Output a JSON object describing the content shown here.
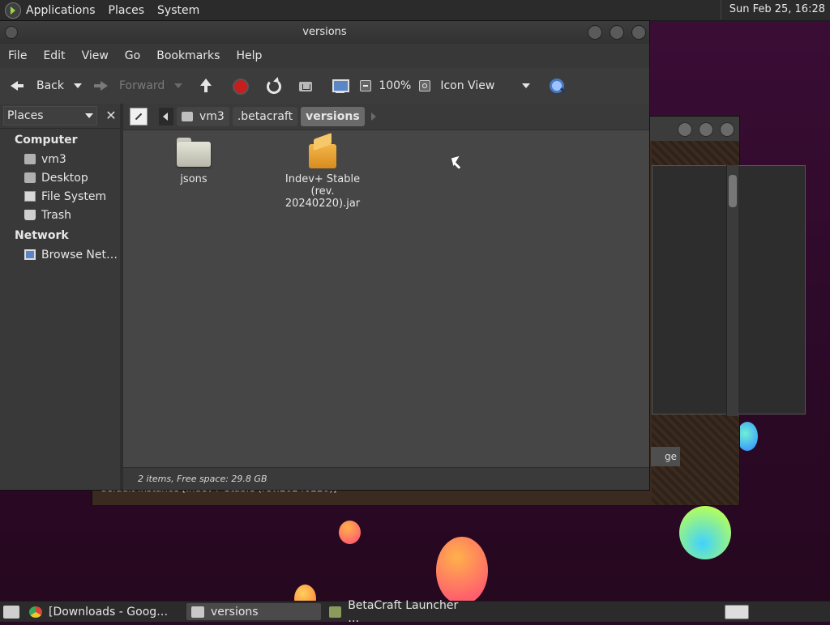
{
  "top_panel": {
    "menus": [
      "Applications",
      "Places",
      "System"
    ],
    "clock": "Sun Feb 25, 16:28"
  },
  "window": {
    "title": "versions",
    "menu": [
      "File",
      "Edit",
      "View",
      "Go",
      "Bookmarks",
      "Help"
    ],
    "toolbar": {
      "back": "Back",
      "forward": "Forward",
      "zoom": "100%",
      "view_mode": "Icon View"
    },
    "sidebar": {
      "selector": "Places",
      "sections": [
        {
          "title": "Computer",
          "items": [
            "vm3",
            "Desktop",
            "File System",
            "Trash"
          ]
        },
        {
          "title": "Network",
          "items": [
            "Browse Net…"
          ]
        }
      ]
    },
    "pathbar": [
      "vm3",
      ".betacraft",
      "versions"
    ],
    "files": [
      {
        "name": "jsons",
        "type": "folder"
      },
      {
        "name": "Indev+ Stable (rev. 20240220).jar",
        "type": "jar"
      }
    ],
    "status": "2 items, Free space: 29.8 GB"
  },
  "background_window": {
    "status_text": "default instance [Indev+ Stable (rev.20240220)]",
    "button_fragment": "ge"
  },
  "taskbar": {
    "tasks": [
      {
        "label": "[Downloads - Goog…",
        "icon": "chrome-icon"
      },
      {
        "label": "versions",
        "icon": "folder-icon",
        "active": true
      },
      {
        "label": "BetaCraft Launcher …",
        "icon": "betacraft-icon"
      }
    ]
  },
  "colors": {
    "stop": "#c41e1e",
    "folder": "#d8d8cc",
    "jar": "#f3b64a"
  }
}
